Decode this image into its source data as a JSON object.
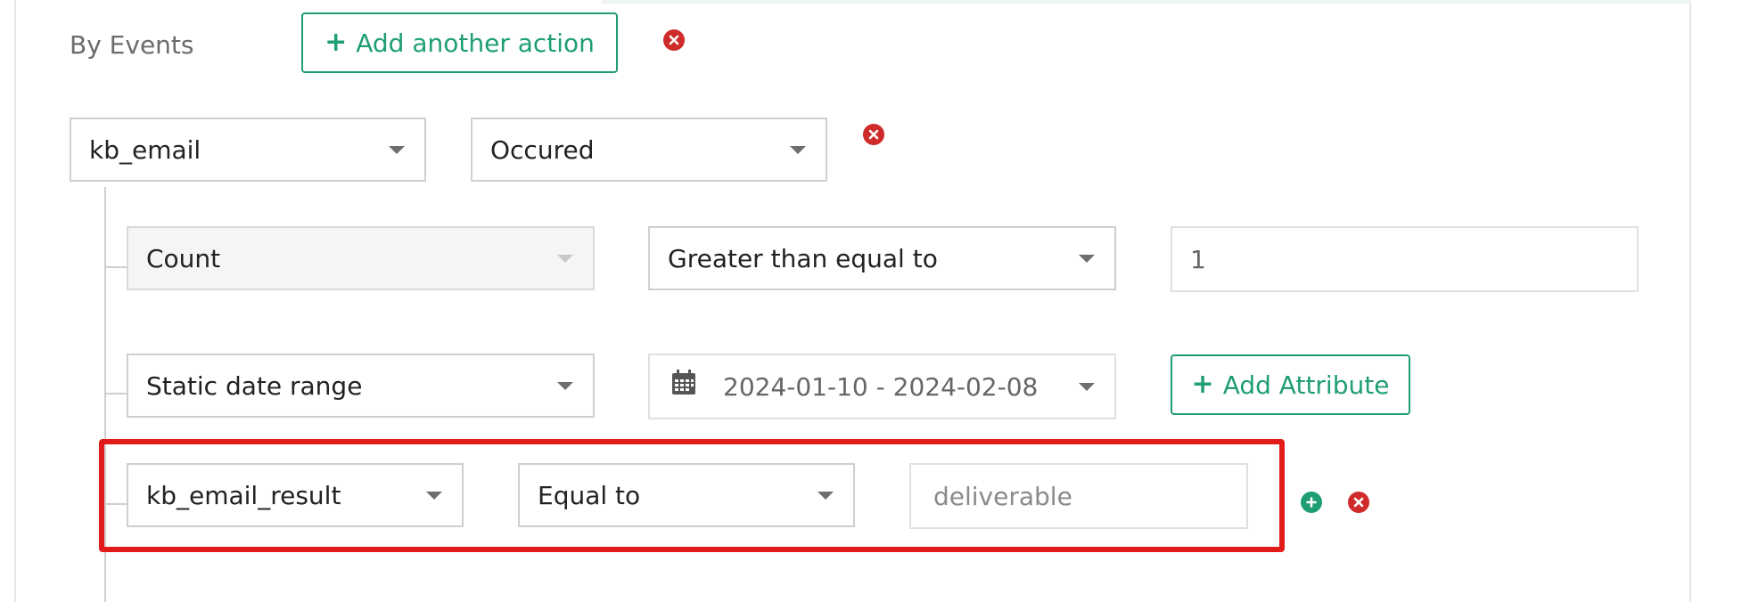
{
  "events": {
    "label": "By Events",
    "add_action_label": "Add another action"
  },
  "event_row": {
    "event_select": "kb_email",
    "condition_select": "Occured"
  },
  "count_row": {
    "metric_select": "Count",
    "operator_select": "Greater than equal to",
    "value_input": "1"
  },
  "date_row": {
    "range_type_select": "Static date range",
    "date_range": "2024-01-10 - 2024-02-08",
    "add_attribute_label": "Add Attribute"
  },
  "attribute_row": {
    "attribute_select": "kb_email_result",
    "operator_select": "Equal to",
    "value_placeholder": "deliverable"
  },
  "colors": {
    "accent": "#1f9e75",
    "danger": "#cf2b2b",
    "highlight": "#e21b1b"
  },
  "icons": [
    "plus-icon",
    "remove-icon",
    "calendar-icon",
    "chevron-down-icon",
    "add-icon"
  ]
}
